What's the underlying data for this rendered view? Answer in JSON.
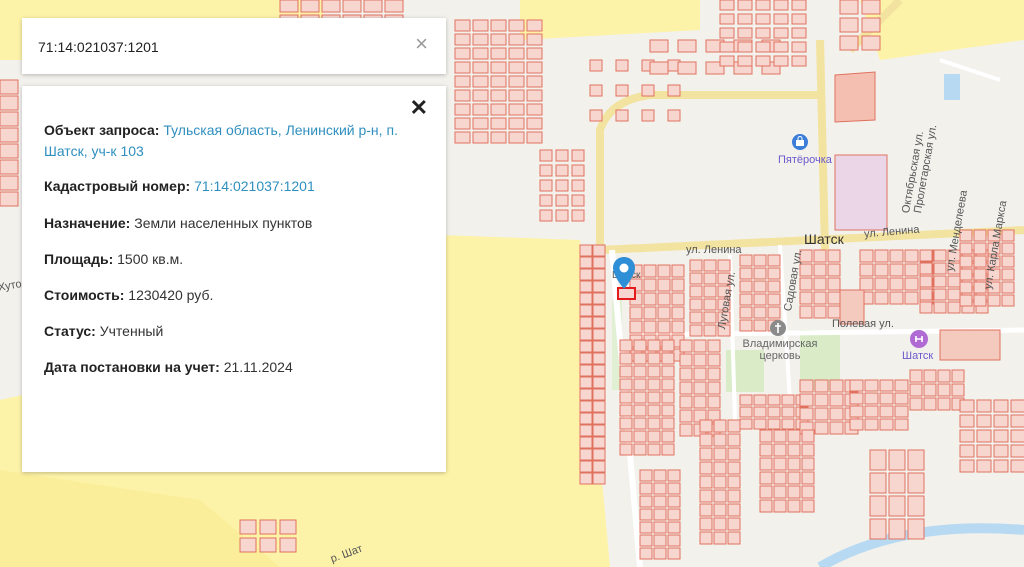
{
  "search": {
    "value": "71:14:021037:1201"
  },
  "info": {
    "object_label": "Объект запроса:",
    "object_value": "Тульская область, Ленинский р-н, п. Шатск, уч-к 103",
    "cadastral_label": "Кадастровый номер:",
    "cadastral_value": "71:14:021037:1201",
    "purpose_label": "Назначение:",
    "purpose_value": "Земли населенных пунктов",
    "area_label": "Площадь:",
    "area_value": "1500 кв.м.",
    "cost_label": "Стоимость:",
    "cost_value": "1230420 руб.",
    "status_label": "Статус:",
    "status_value": "Учтенный",
    "date_label": "Дата постановки на учет:",
    "date_value": "21.11.2024"
  },
  "map": {
    "labels": {
      "settlement": "Шатск",
      "street_lenina_1": "ул. Ленина",
      "street_lenina_2": "ул. Ленина",
      "street_polevaya": "Полевая ул.",
      "street_sadovaya": "Садовая ул.",
      "street_lugovaya": "Луговая ул.",
      "street_oktyabrskaya": "Октябрьская ул.",
      "street_proletarskaya": "Пролетарская ул.",
      "street_mendeleeva": "ул. Менделеева",
      "street_karla_marksa": "ул. Карла Маркса",
      "church": "Владимирская церковь",
      "pyaterochka": "Пятёрочка",
      "station": "Шатск",
      "khutor": "Хуто",
      "river": "р. Шат",
      "marker_text": "Шатск"
    },
    "colors": {
      "parcel_fill": "#f6d6cf",
      "parcel_stroke": "#e0715f",
      "field_yellow": "#fdf3a8",
      "green": "#d9ecc7",
      "road": "#ffffff",
      "major_road": "#f6e7a1",
      "marker": "#2f8fd6",
      "selected_parcel": "#e41a1c"
    },
    "icons": [
      "map-pin-icon",
      "shopping-bag-icon",
      "church-icon",
      "station-icon",
      "close-icon"
    ]
  }
}
